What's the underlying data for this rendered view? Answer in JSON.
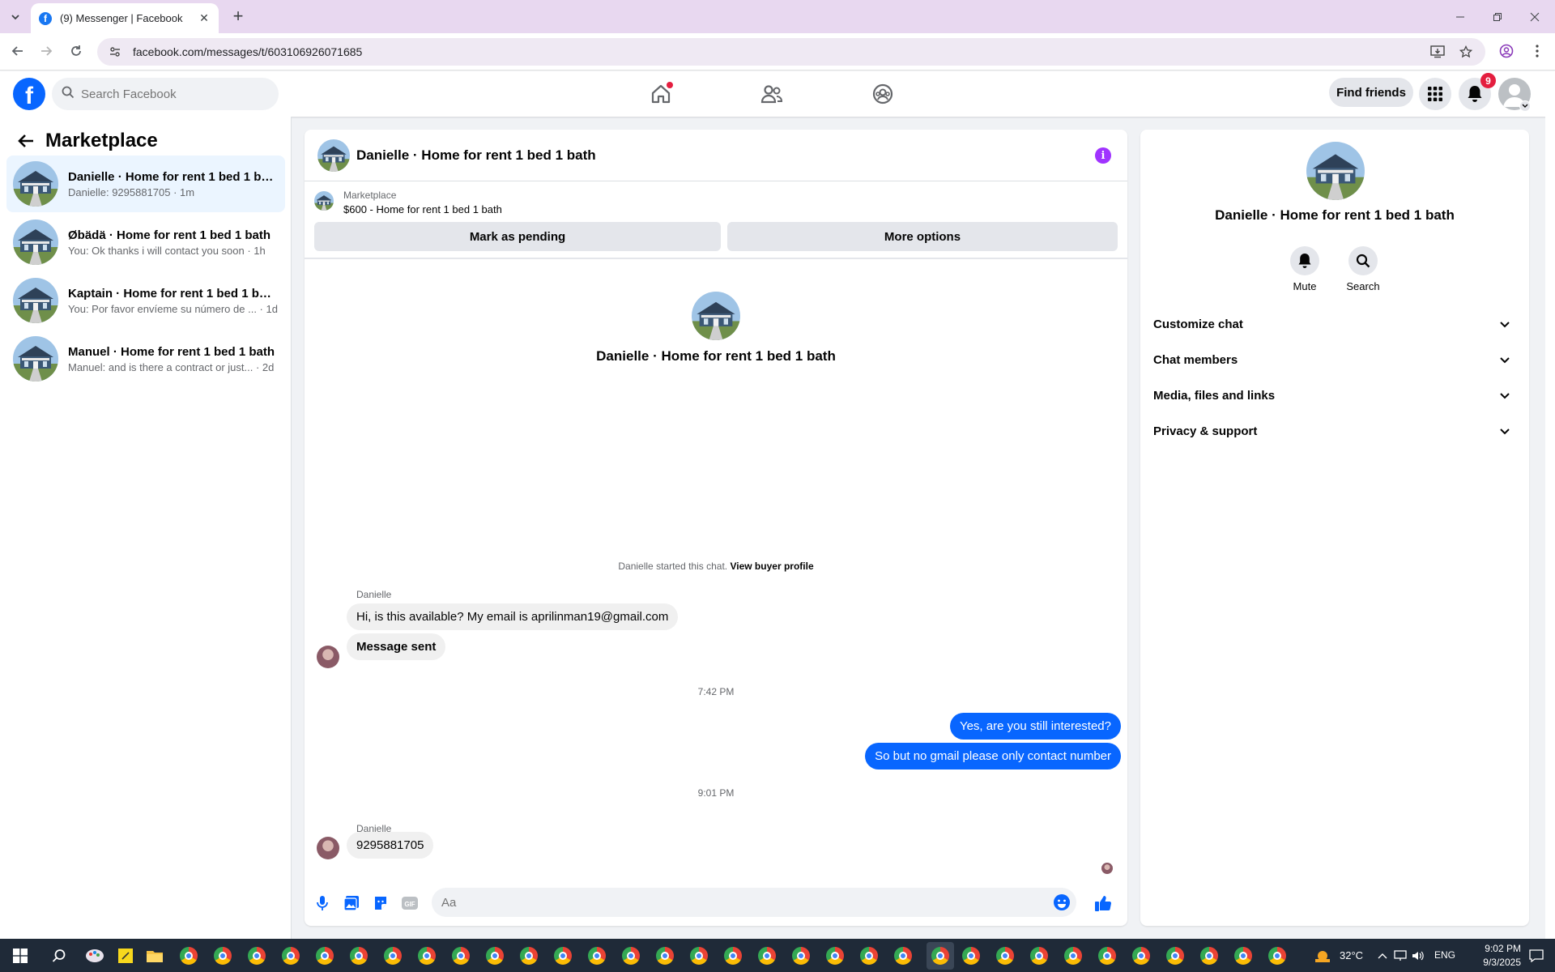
{
  "browser": {
    "tab_title": "(9) Messenger | Facebook",
    "url": "facebook.com/messages/t/603106926071685"
  },
  "fb": {
    "search_placeholder": "Search Facebook",
    "find_friends": "Find friends",
    "notification_count": "9"
  },
  "sidebar": {
    "title": "Marketplace",
    "conversations": [
      {
        "name": "Danielle · Home for rent 1 bed 1 ba...",
        "preview": "Danielle: 9295881705 · 1m",
        "active": true
      },
      {
        "name": "Øbädä · Home for rent 1 bed 1 bath",
        "preview": "You: Ok thanks i will contact you soon · 1h"
      },
      {
        "name": "Kaptain · Home for rent 1 bed 1 bath",
        "preview": "You: Por favor envíeme su número de ... · 1d"
      },
      {
        "name": "Manuel · Home for rent 1 bed 1 bath",
        "preview": "Manuel: and is there a contract or just... · 2d"
      }
    ]
  },
  "chat": {
    "title": "Danielle · Home for rent 1 bed 1 bath",
    "marketplace_label": "Marketplace",
    "listing": "$600 - Home for rent 1 bed 1 bath",
    "mark_pending": "Mark as pending",
    "more_options": "More options",
    "intro_name": "Danielle · Home for rent 1 bed 1 bath",
    "started_text": "Danielle started this chat.",
    "view_profile": "View buyer profile",
    "sender1": "Danielle",
    "msg1": "Hi, is this available? My email is aprilinman19@gmail.com",
    "msg2": "Message sent",
    "time1": "7:42 PM",
    "msg3": "Yes, are you still interested?",
    "msg4": "So but no gmail please only contact number",
    "time2": "9:01 PM",
    "sender2": "Danielle",
    "msg5": "9295881705",
    "composer_placeholder": "Aa"
  },
  "panel": {
    "name": "Danielle · Home for rent 1 bed 1 bath",
    "mute": "Mute",
    "search": "Search",
    "sections": [
      "Customize chat",
      "Chat members",
      "Media, files and links",
      "Privacy & support"
    ]
  },
  "taskbar": {
    "weather": "32°C",
    "lang": "ENG",
    "time": "9:02 PM",
    "date": "9/3/2025"
  },
  "colors": {
    "fb_blue": "#0866ff",
    "active_row": "#ebf5ff",
    "info_purple": "#a033ff"
  }
}
